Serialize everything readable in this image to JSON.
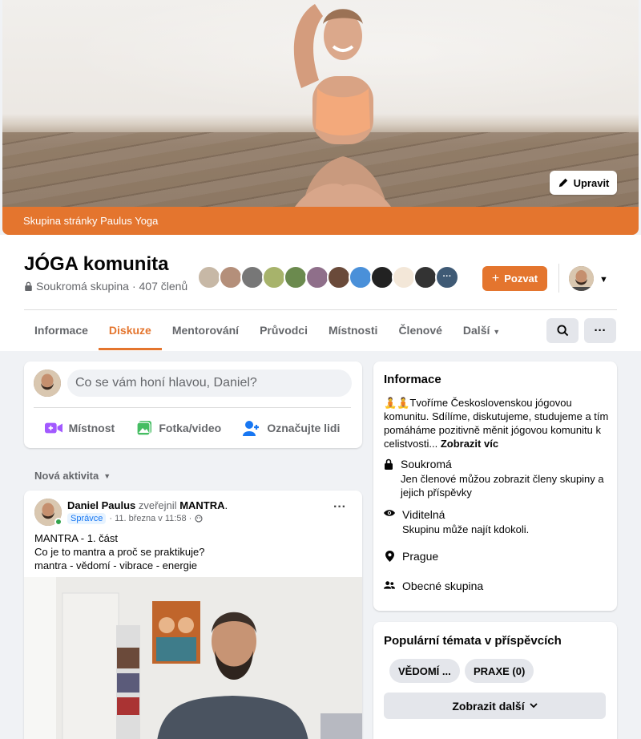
{
  "cover": {
    "edit_label": "Upravit",
    "band_text": "Skupina stránky Paulus Yoga",
    "band_color": "#e4752e"
  },
  "header": {
    "title": "JÓGA komunita",
    "privacy": "Soukromá skupina",
    "members": "· 407 členů",
    "invite_label": "Pozvat",
    "tabs": [
      "Informace",
      "Diskuze",
      "Mentorování",
      "Průvodci",
      "Místnosti",
      "Členové",
      "Další"
    ],
    "active_tab": "Diskuze",
    "member_avatar_count": 12
  },
  "composer": {
    "placeholder": "Co se vám honí hlavou, Daniel?",
    "actions": [
      {
        "label": "Místnost",
        "icon": "video-room-icon",
        "color": "#a259ff"
      },
      {
        "label": "Fotka/video",
        "icon": "photo-icon",
        "color": "#45bd62"
      },
      {
        "label": "Označujte lidi",
        "icon": "tag-people-icon",
        "color": "#1877f2"
      }
    ]
  },
  "feed": {
    "sort_label": "Nová aktivita"
  },
  "post": {
    "author": "Daniel Paulus",
    "verb": "zveřejnil",
    "object": "MANTRA",
    "role_badge": "Správce",
    "timestamp": "· 11. března v 11:58 ·",
    "lines": [
      "MANTRA - 1. část",
      "Co je to mantra a proč se praktikuje?",
      "mantra - vědomí - vibrace - energie"
    ]
  },
  "info": {
    "title": "Informace",
    "description": "🧘🧘Tvoříme Československou jógovou komunitu. Sdílíme, diskutujeme, studujeme a tím pomáháme pozitivně měnit jógovou komunitu k celistvosti...",
    "show_more": "Zobrazit víc",
    "rows": [
      {
        "icon": "lock-icon",
        "title": "Soukromá",
        "sub": "Jen členové můžou zobrazit členy skupiny a jejich příspěvky"
      },
      {
        "icon": "eye-icon",
        "title": "Viditelná",
        "sub": "Skupinu může najít kdokoli."
      },
      {
        "icon": "location-pin-icon",
        "title": "Prague",
        "sub": ""
      },
      {
        "icon": "people-icon",
        "title": "Obecné skupina",
        "sub": ""
      }
    ]
  },
  "topics": {
    "title": "Populární témata v příspěvcích",
    "chips": [
      "VĚDOMÍ ...",
      "PRAXE (0)"
    ],
    "show_more": "Zobrazit další"
  }
}
